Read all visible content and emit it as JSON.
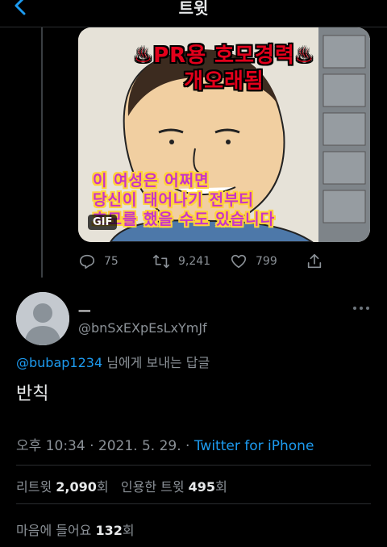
{
  "header": {
    "title": "트윗",
    "back_icon": "chevron-left-icon"
  },
  "media": {
    "headline_line1": "♨PR용 호모경력♨",
    "headline_line2": "개오래됨",
    "caption_line1": "이 여성은 어쩌면",
    "caption_line2": "당신이 태어나기 전부터",
    "caption_line3": "호모를 했을 수도 있습니다",
    "badge": "GIF",
    "colors": {
      "headline": "#e3001b",
      "caption": "#c833c9",
      "caption_outline": "#ffd23a"
    }
  },
  "parent_actions": {
    "reply_count": "75",
    "retweet_count": "9,241",
    "like_count": "799"
  },
  "tweet": {
    "display_name": "ㅡ",
    "handle": "@bnSxEXpEsLxYmJf",
    "replying_handle": "@bubap1234",
    "replying_suffix": " 님에게 보내는 답글",
    "text": "반칙",
    "time": "오후 10:34",
    "date": "2021. 5. 29.",
    "separator": "·",
    "source": "Twitter for iPhone"
  },
  "stats": {
    "retweets_label": "리트윗",
    "retweets_count": "2,090",
    "retweets_unit": "회",
    "quotes_label": "인용한 트윗",
    "quotes_count": "495",
    "quotes_unit": "회",
    "likes_label": "마음에 들어요",
    "likes_count": "132",
    "likes_unit": "회"
  },
  "accent_color": "#1d9bf0"
}
